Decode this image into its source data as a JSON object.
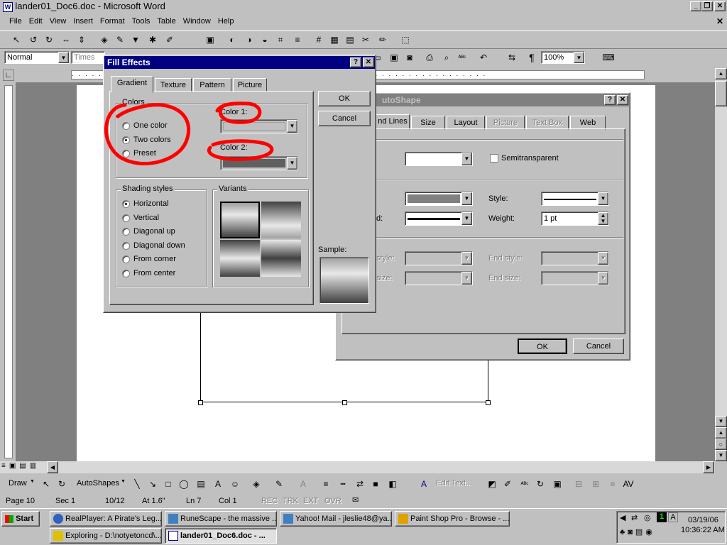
{
  "window": {
    "title": "lander01_Doc6.doc - Microsoft Word"
  },
  "menu": [
    "File",
    "Edit",
    "View",
    "Insert",
    "Format",
    "Tools",
    "Table",
    "Window",
    "Help"
  ],
  "format_toolbar": {
    "style": "Normal",
    "font": "Times Ne",
    "zoom": "100%"
  },
  "fill_effects": {
    "title": "Fill Effects",
    "tabs": [
      "Gradient",
      "Texture",
      "Pattern",
      "Picture"
    ],
    "colors_group": "Colors",
    "color_options": [
      "One color",
      "Two colors",
      "Preset"
    ],
    "selected_color_option": "Two colors",
    "color1_label": "Color 1:",
    "color2_label": "Color 2:",
    "shading_group": "Shading styles",
    "shading_options": [
      "Horizontal",
      "Vertical",
      "Diagonal up",
      "Diagonal down",
      "From corner",
      "From center"
    ],
    "selected_shading": "Horizontal",
    "variants_group": "Variants",
    "sample_label": "Sample:",
    "ok": "OK",
    "cancel": "Cancel"
  },
  "format_autoshape": {
    "title": "Format AutoShape",
    "title_visible": "utoShape",
    "tabs": [
      "Colors and Lines",
      "Size",
      "Layout",
      "Picture",
      "Text Box",
      "Web"
    ],
    "tabs_visible": [
      "nd Lines",
      "Size",
      "Layout",
      "Picture",
      "Text Box",
      "Web"
    ],
    "semitransparent": "Semitransparent",
    "style_label": "Style:",
    "dashed_label": "d:",
    "weight_label": "Weight:",
    "weight_value": "1 pt",
    "begin_style_label": "style:",
    "end_style_label": "End style:",
    "begin_size_label": "size:",
    "end_size_label": "End size:",
    "ok": "OK",
    "cancel": "Cancel"
  },
  "drawing_toolbar": {
    "draw": "Draw",
    "autoshapes": "AutoShapes",
    "edit_text": "Edit Text..."
  },
  "status_bar": {
    "page": "Page  10",
    "sec": "Sec  1",
    "pages": "10/12",
    "at": "At  1.6\"",
    "ln": "Ln  7",
    "col": "Col  1",
    "rec": "REC",
    "trk": "TRK",
    "ext": "EXT",
    "ovr": "OVR"
  },
  "taskbar": {
    "start": "Start",
    "tasks_row1": [
      "RealPlayer: A Pirate's Leg...",
      "RuneScape - the massive ...",
      "Yahoo! Mail - jleslie48@ya...",
      "Paint Shop Pro - Browse - ..."
    ],
    "tasks_row2": [
      "Exploring - D:\\notyetoncd\\...",
      "lander01_Doc6.doc - ..."
    ],
    "date": "03/19/06",
    "time": "10:36:22 AM",
    "tray_num": "1",
    "tray_letter": "A"
  },
  "colors": {
    "annotation": "#ff0000",
    "title_active": "#000080",
    "face": "#c0c0c0"
  }
}
